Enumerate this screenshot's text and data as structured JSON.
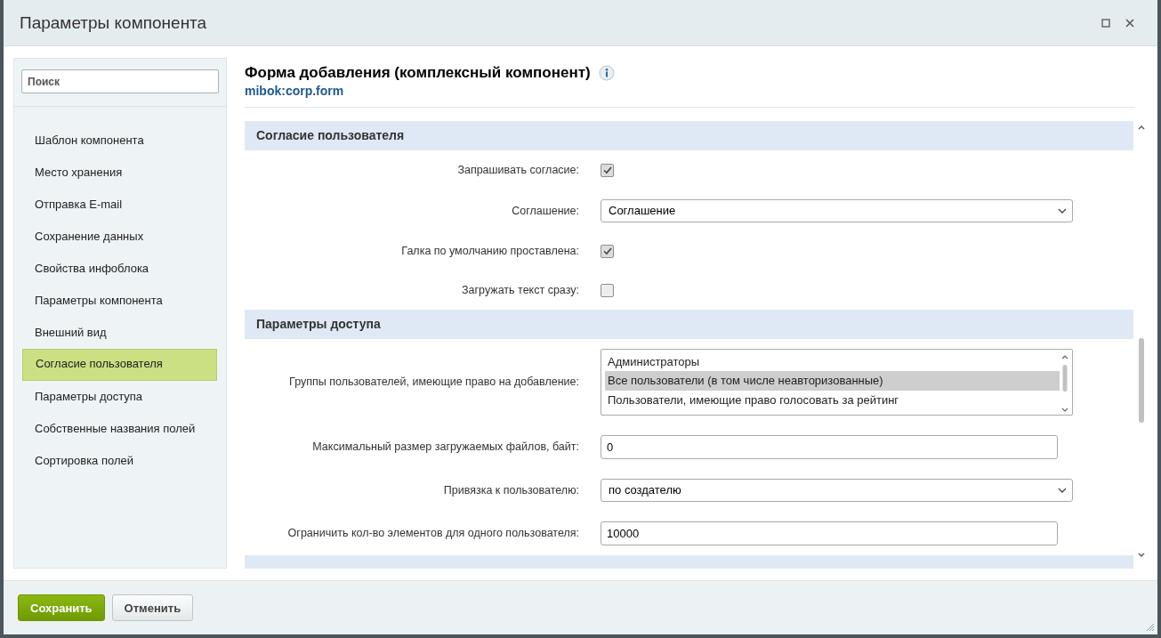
{
  "window": {
    "title": "Параметры компонента"
  },
  "sidebar": {
    "search": {
      "placeholder": "Поиск"
    },
    "items": [
      {
        "label": "Шаблон компонента",
        "selected": false
      },
      {
        "label": "Место хранения",
        "selected": false
      },
      {
        "label": "Отправка E-mail",
        "selected": false
      },
      {
        "label": "Сохранение данных",
        "selected": false
      },
      {
        "label": "Свойства инфоблока",
        "selected": false
      },
      {
        "label": "Параметры компонента",
        "selected": false
      },
      {
        "label": "Внешний вид",
        "selected": false
      },
      {
        "label": "Согласие пользователя",
        "selected": true
      },
      {
        "label": "Параметры доступа",
        "selected": false
      },
      {
        "label": "Собственные названия полей",
        "selected": false
      },
      {
        "label": "Сортировка полей",
        "selected": false
      }
    ]
  },
  "component": {
    "title": "Форма добавления (комплексный компонент)",
    "code": "mibok:corp.form"
  },
  "sections": [
    {
      "title": "Согласие пользователя",
      "fields": [
        {
          "kind": "checkbox",
          "label": "Запрашивать согласие:",
          "checked": true
        },
        {
          "kind": "select",
          "label": "Соглашение:",
          "value": "Соглашение"
        },
        {
          "kind": "checkbox",
          "label": "Галка по умолчанию проставлена:",
          "checked": true
        },
        {
          "kind": "checkbox",
          "label": "Загружать текст сразу:",
          "checked": false
        }
      ]
    },
    {
      "title": "Параметры доступа",
      "fields": [
        {
          "kind": "multiselect",
          "label": "Группы пользователей, имеющие право на добавление:",
          "options": [
            {
              "label": "Администраторы",
              "selected": false
            },
            {
              "label": "Все пользователи (в том числе неавторизованные)",
              "selected": true
            },
            {
              "label": "Пользователи, имеющие право голосовать за рейтинг",
              "selected": false
            }
          ]
        },
        {
          "kind": "text",
          "label": "Максимальный размер загружаемых файлов, байт:",
          "value": "0"
        },
        {
          "kind": "select",
          "label": "Привязка к пользователю:",
          "value": "по создателю"
        },
        {
          "kind": "text",
          "label": "Ограничить кол-во элементов для одного пользователя:",
          "value": "10000"
        }
      ]
    }
  ],
  "buttons": [
    {
      "label": "Сохранить",
      "kind": "primary"
    },
    {
      "label": "Отменить",
      "kind": "secondary"
    }
  ]
}
